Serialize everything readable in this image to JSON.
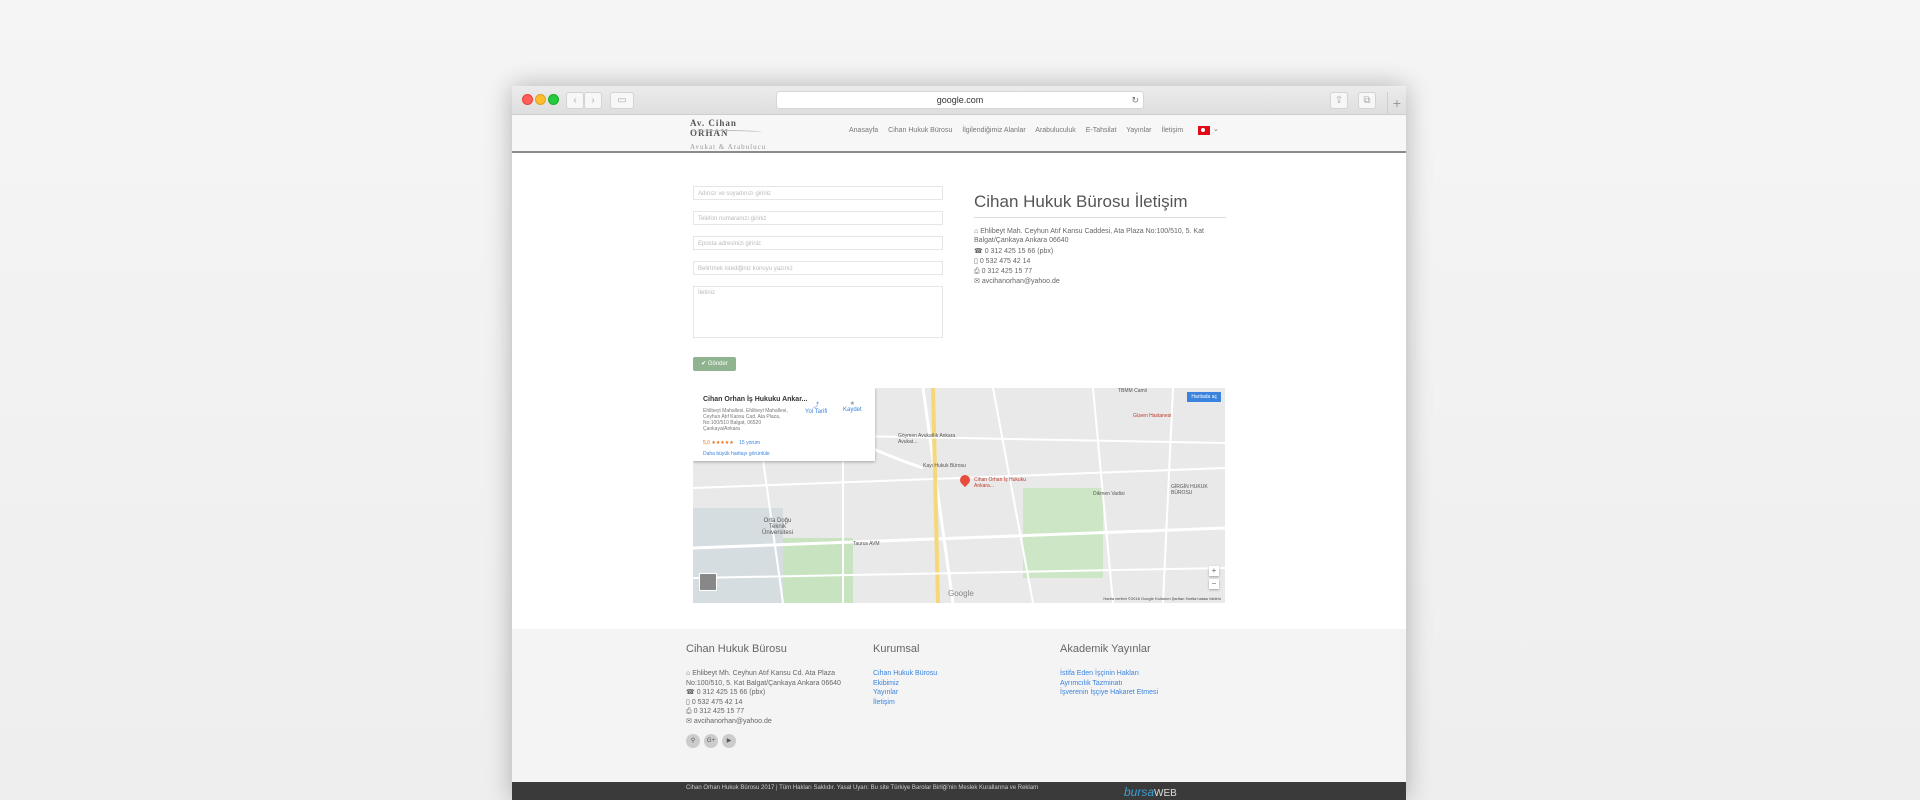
{
  "browser": {
    "url": "google.com"
  },
  "site": {
    "logo_name": "Av. Cihan ORHAN",
    "logo_tagline": "Avukat & Arabulucu",
    "nav": [
      "Anasayfa",
      "Cihan Hukuk Bürosu",
      "İlgilendiğimiz Alanlar",
      "Arabuluculuk",
      "E-Tahsilat",
      "Yayınlar",
      "İletişim"
    ]
  },
  "form": {
    "name_placeholder": "Adınızı ve soyadınızı giriniz",
    "phone_placeholder": "Telefon numaranızı giriniz",
    "email_placeholder": "Eposta adresinizi giriniz",
    "subject_placeholder": "Belirtmek istediğiniz konuyu yazınız",
    "message_placeholder": "İletiniz",
    "send_label": "✔ Gönder"
  },
  "contact": {
    "title": "Cihan Hukuk Bürosu İletişim",
    "address": "Ehlibeyt Mah. Ceyhun Atıf Kansu Caddesi, Ata Plaza No:100/510, 5. Kat Balgat/Çankaya Ankara 06640",
    "phone": "0 312 425 15 66 (pbx)",
    "mobile": "0 532 475 42 14",
    "fax": "0 312 425 15 77",
    "email": "avcihanorhan@yahoo.de"
  },
  "map": {
    "card_title": "Cihan Orhan İş Hukuku Ankar...",
    "card_address": "Ehlibeyt Mahallesi, Ehlibeyt Mahallesi, Ceyhun Atıf Kansu Cad. Ata Plaza, No:100/510 Balgat, 06520 Çankaya/Ankara",
    "rating": "5,0 ★★★★★",
    "reviews": "15 yorum",
    "larger_map": "Daha büyük haritayı görüntüle",
    "directions": "Yol Tarifi",
    "save": "Kaydet",
    "open_map": "Haritada aç",
    "pin_label": "Cihan Orhan İş Hukuku Ankara...",
    "labels": {
      "goymen": "Göymen Avukatlık Ankara Avukat...",
      "kayi": "Kayı Hukuk Bürosu",
      "odtu": "Orta Doğu Teknik Üniversitesi",
      "taurus": "Taurus AVM",
      "dikmen": "Dikmen Vadisi",
      "tbmm": "TBMM Camii",
      "guven": "Güven Hastanesi",
      "girgin": "GİRGİN HUKUK BÜROSU"
    },
    "footer": "Harita verileri ©2018 Google   Kullanım Şartları   Harita hatası bildirin",
    "google": "Google"
  },
  "footer": {
    "col1_title": "Cihan Hukuk Bürosu",
    "col1_address": "Ehlibeyt Mh. Ceyhun Atıf Kansu Cd. Ata Plaza No:100/510, 5. Kat Balgat/Çankaya Ankara 06640",
    "col1_phone": "0 312 425 15 66 (pbx)",
    "col1_mobile": "0 532 475 42 14",
    "col1_fax": "0 312 425 15 77",
    "col1_email": "avcihanorhan@yahoo.de",
    "col2_title": "Kurumsal",
    "col2_links": [
      "Cihan Hukuk Bürosu",
      "Ekibimiz",
      "Yayınlar",
      "İletişim"
    ],
    "col3_title": "Akademik Yayınlar",
    "col3_links": [
      "İstifa Eden İşçinin Hakları",
      "Ayrımcılık Tazminatı",
      "İşverenin İşçiye Hakaret Etmesi"
    ]
  },
  "bottom": {
    "copyright": "Cihan Orhan Hukuk Bürosu 2017 | Tüm Hakları Saklıdır. Yasal Uyarı: Bu site Türkiye Barolar Birliği'nin Meslek Kurallarına ve Reklam",
    "brand_main": "bursa",
    "brand_web": "WEB"
  },
  "colors": {
    "accent": "#3a84df",
    "send_button": "#8fb48f",
    "bottom_bar": "#3a3a3a"
  }
}
